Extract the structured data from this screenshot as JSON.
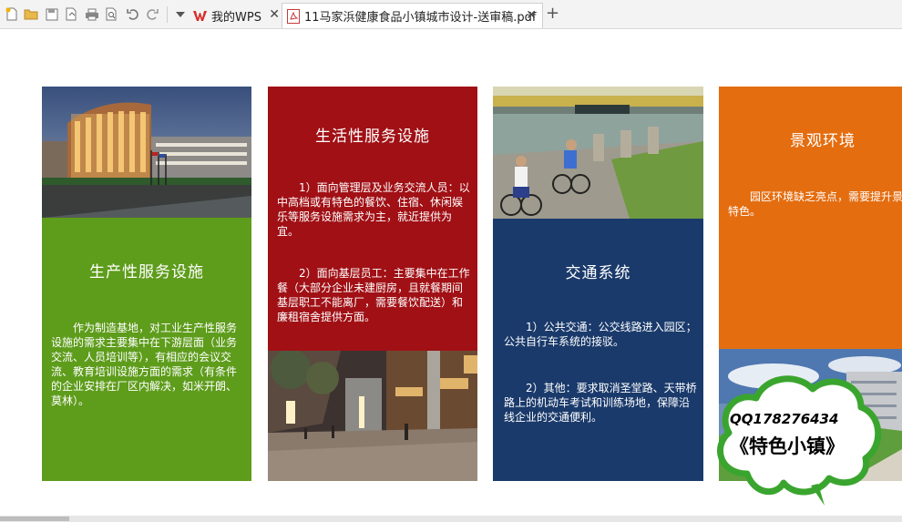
{
  "toolbar": {
    "icons": [
      "new-file-icon",
      "open-folder-icon",
      "save-icon",
      "export-icon",
      "print-icon",
      "print-preview-icon",
      "undo-icon",
      "redo-icon",
      "dropdown-icon"
    ]
  },
  "tabs": [
    {
      "label": "我的WPS",
      "active": false
    },
    {
      "label": "11马家浜健康食品小镇城市设计-送审稿.pdf",
      "active": true
    }
  ],
  "slide": {
    "panels": [
      {
        "id": "production",
        "heading": "生产性服务设施",
        "color": "#5e9c1b",
        "paragraphs": [
          "作为制造基地，对工业生产性服务设施的需求主要集中在下游层面（业务交流、人员培训等），有相应的会议交流、教育培训设施方面的需求（有条件的企业安排在厂区内解决，如米开朗、莫林）。"
        ]
      },
      {
        "id": "life",
        "heading": "生活性服务设施",
        "color": "#a01015",
        "paragraphs": [
          "1）面向管理层及业务交流人员：以中高档或有特色的餐饮、住宿、休闲娱乐等服务设施需求为主，就近提供为宜。",
          "2）面向基层员工：主要集中在工作餐（大部分企业未建厨房，且就餐期间基层职工不能离厂，需要餐饮配送）和廉租宿舍提供方面。"
        ]
      },
      {
        "id": "transport",
        "heading": "交通系统",
        "color": "#1a3a6b",
        "paragraphs": [
          "1）公共交通：公交线路进入园区；公共自行车系统的接驳。",
          "2）其他：要求取消圣堂路、天带桥路上的机动车考试和训练场地，保障沿线企业的交通便利。"
        ]
      },
      {
        "id": "landscape",
        "heading": "景观环境",
        "color": "#e46d10",
        "paragraphs": [
          "园区环境缺乏亮点，需要提升景观特色。"
        ]
      }
    ]
  },
  "watermark": {
    "qq": "QQ178276434",
    "brand": "《特色小镇》",
    "color": "#3aa52e"
  }
}
